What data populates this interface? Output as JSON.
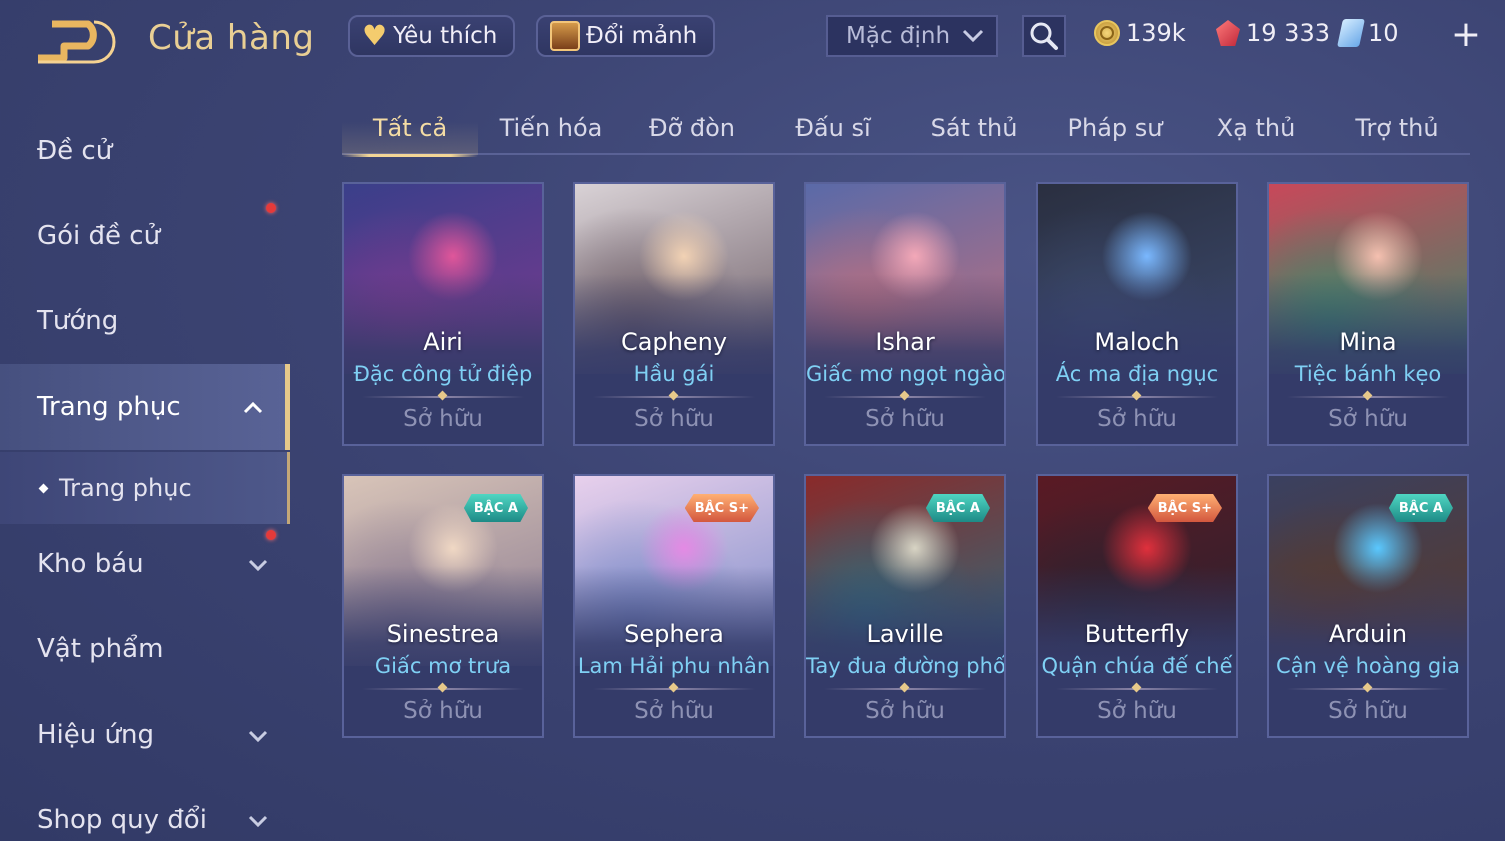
{
  "header": {
    "title": "Cửa hàng",
    "favorites_label": "Yêu thích",
    "exchange_label": "Đổi mảnh",
    "sort_value": "Mặc định",
    "gold": "139k",
    "gems": "19 333",
    "tickets": "10"
  },
  "sidebar": {
    "items": [
      {
        "label": "Đề cử"
      },
      {
        "label": "Gói đề cử"
      },
      {
        "label": "Tướng"
      },
      {
        "label": "Trang phục"
      },
      {
        "label": "Trang phục"
      },
      {
        "label": "Kho báu"
      },
      {
        "label": "Vật phẩm"
      },
      {
        "label": "Hiệu ứng"
      },
      {
        "label": "Shop quy đổi"
      }
    ]
  },
  "tabs": [
    {
      "label": "Tất cả"
    },
    {
      "label": "Tiến hóa"
    },
    {
      "label": "Đỡ đòn"
    },
    {
      "label": "Đấu sĩ"
    },
    {
      "label": "Sát thủ"
    },
    {
      "label": "Pháp sư"
    },
    {
      "label": "Xạ thủ"
    },
    {
      "label": "Trợ thủ"
    }
  ],
  "cards": [
    {
      "hero": "Airi",
      "skin": "Đặc công tử điệp",
      "status": "Sở hữu",
      "badge": "",
      "c1": "#3a3f8a",
      "c2": "#7a3a8f",
      "accent": "#e0569a"
    },
    {
      "hero": "Capheny",
      "skin": "Hầu gái",
      "status": "Sở hữu",
      "badge": "",
      "c1": "#d9d2d6",
      "c2": "#6a5a64",
      "accent": "#f2d2b4"
    },
    {
      "hero": "Ishar",
      "skin": "Giấc mơ ngọt ngào",
      "status": "Sở hữu",
      "badge": "",
      "c1": "#5a6aa8",
      "c2": "#c0707e",
      "accent": "#f3a8b8"
    },
    {
      "hero": "Maloch",
      "skin": "Ác ma địa ngục",
      "status": "Sở hữu",
      "badge": "",
      "c1": "#2a2f40",
      "c2": "#3c4a6e",
      "accent": "#7ab8ff"
    },
    {
      "hero": "Mina",
      "skin": "Tiệc bánh kẹo",
      "status": "Sở hữu",
      "badge": "",
      "c1": "#c8485a",
      "c2": "#3a8a6a",
      "accent": "#f5c0b0"
    },
    {
      "hero": "Sinestrea",
      "skin": "Giấc mơ trưa",
      "status": "Sở hữu",
      "badge": "BẬC A",
      "c1": "#d8c4b8",
      "c2": "#8a7a90",
      "accent": "#f0d8c4"
    },
    {
      "hero": "Sephera",
      "skin": "Lam Hải phu nhân",
      "status": "Sở hữu",
      "badge": "BẬC S+",
      "c1": "#e8d0ec",
      "c2": "#7a8ac8",
      "accent": "#e48ae4"
    },
    {
      "hero": "Laville",
      "skin": "Tay đua đường phố",
      "status": "Sở hữu",
      "badge": "BẬC A",
      "c1": "#8a2a2a",
      "c2": "#2f6a7a",
      "accent": "#d8d4c4"
    },
    {
      "hero": "Butterfly",
      "skin": "Quận chúa đế chế",
      "status": "Sở hữu",
      "badge": "BẬC S+",
      "c1": "#5a1a24",
      "c2": "#2a2230",
      "accent": "#e0303c"
    },
    {
      "hero": "Arduin",
      "skin": "Cận vệ hoàng gia",
      "status": "Sở hữu",
      "badge": "BẬC A",
      "c1": "#3a4060",
      "c2": "#5a3a2a",
      "accent": "#5ac8ff"
    }
  ]
}
